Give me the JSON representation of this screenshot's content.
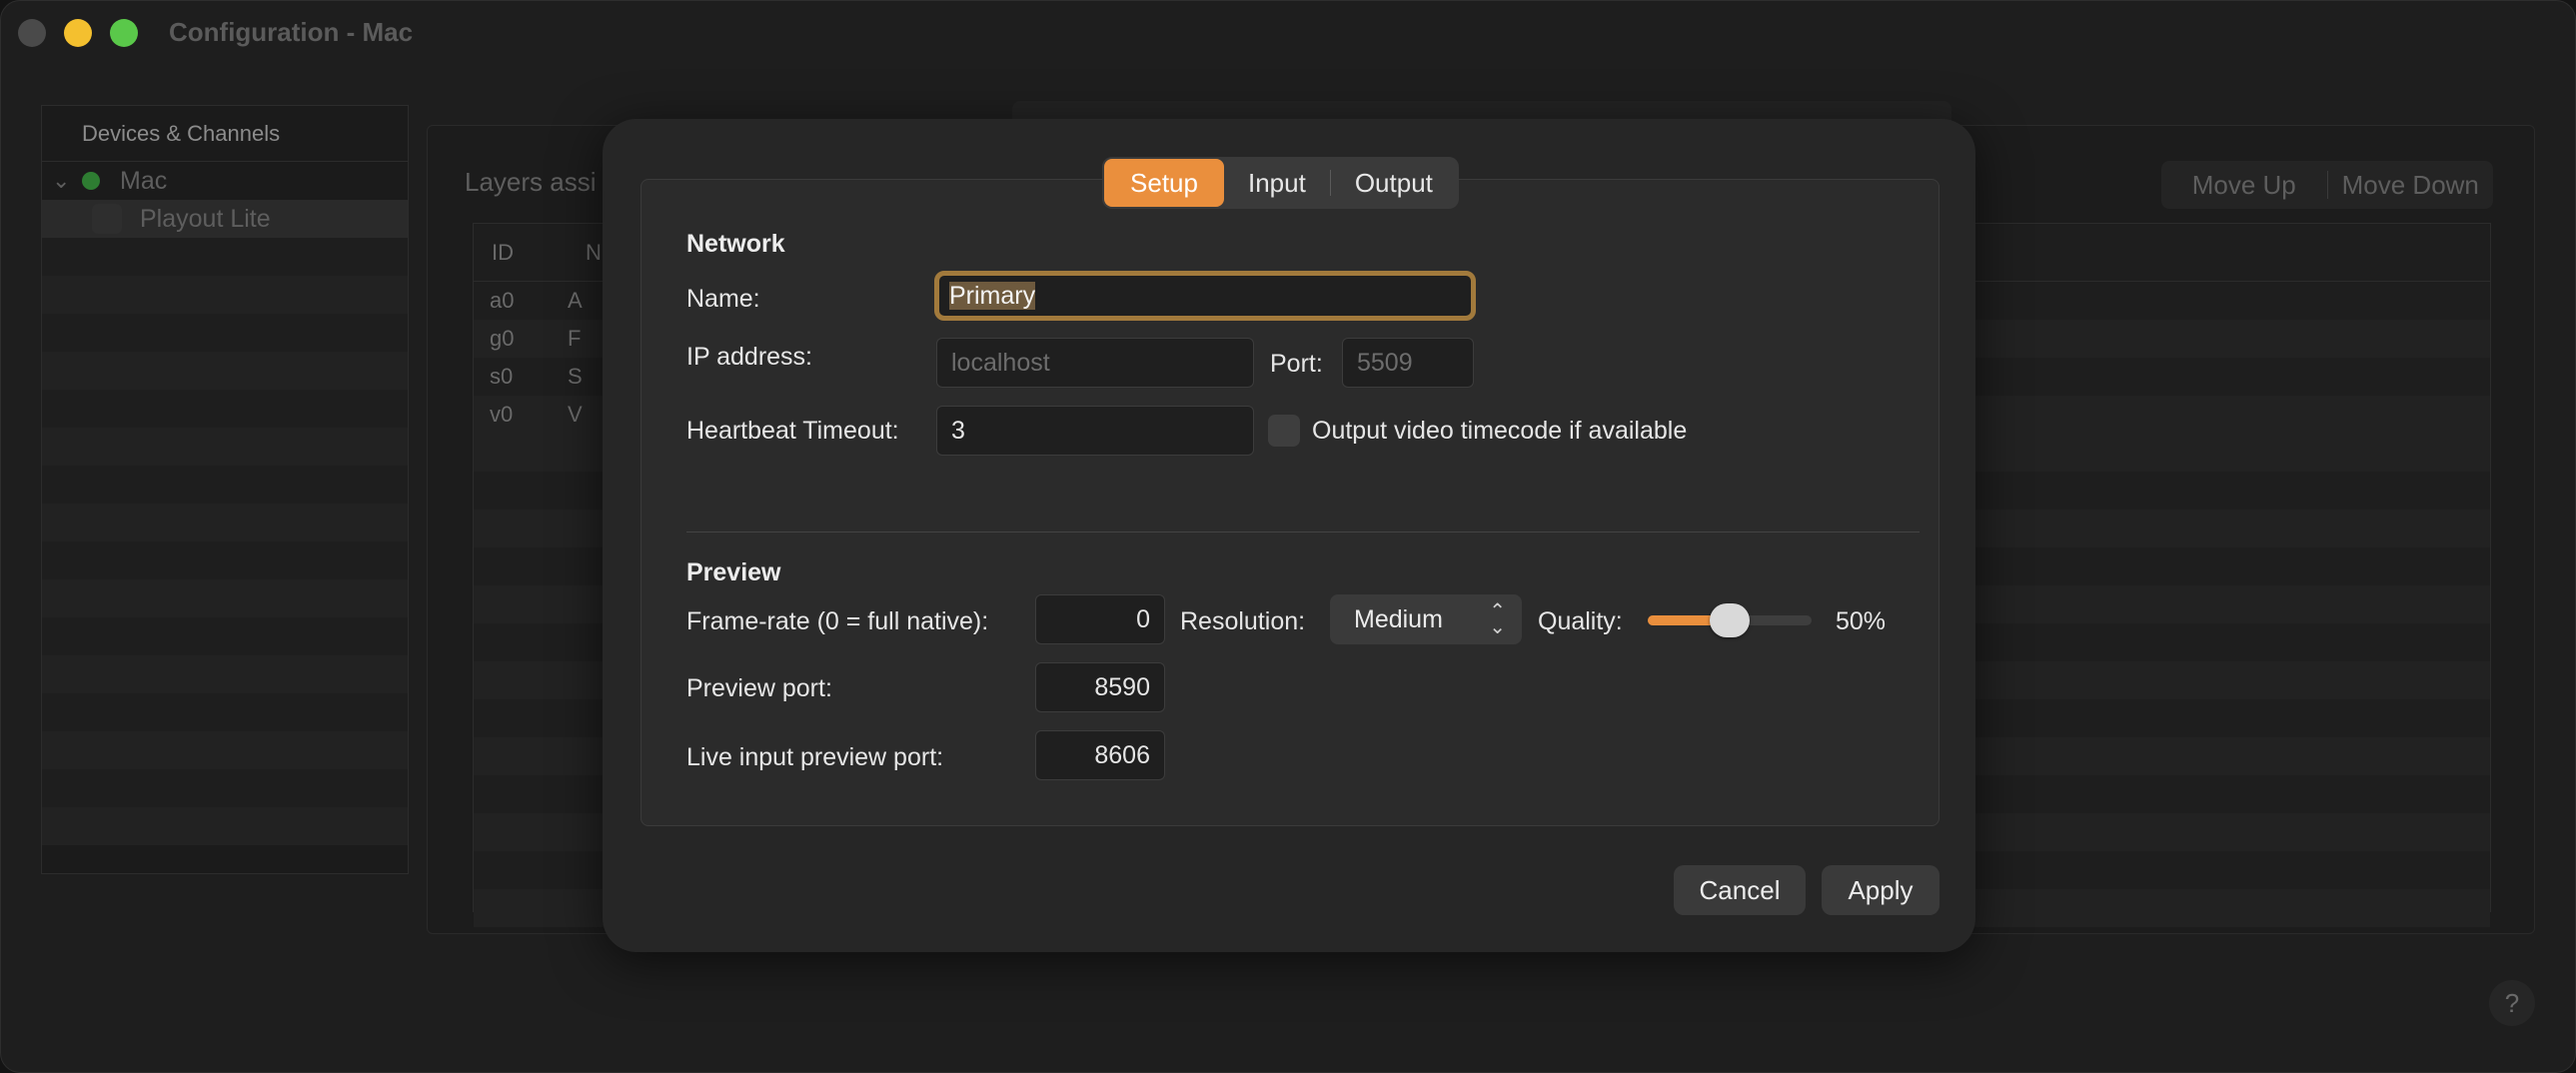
{
  "window": {
    "title": "Configuration - Mac"
  },
  "sidebar": {
    "header": "Devices & Channels",
    "device": {
      "name": "Mac",
      "status_color": "#2e7d32"
    },
    "channel": {
      "name": "Playout Lite"
    }
  },
  "background": {
    "section_label": "Layers assi",
    "move_up": "Move Up",
    "move_down": "Move Down",
    "table": {
      "headers": [
        "ID",
        "N"
      ],
      "rows": [
        {
          "id": "a0",
          "name": "A"
        },
        {
          "id": "g0",
          "name": "F"
        },
        {
          "id": "s0",
          "name": "S"
        },
        {
          "id": "v0",
          "name": "V"
        }
      ]
    },
    "help": "?"
  },
  "dialog": {
    "tabs": {
      "setup": "Setup",
      "input": "Input",
      "output": "Output",
      "active": "Setup"
    },
    "network": {
      "title": "Network",
      "name_label": "Name:",
      "name_value": "Primary",
      "ip_label": "IP address:",
      "ip_placeholder": "localhost",
      "port_label": "Port:",
      "port_placeholder": "5509",
      "heartbeat_label": "Heartbeat Timeout:",
      "heartbeat_value": "3",
      "timecode_label": "Output video timecode if available",
      "timecode_checked": false
    },
    "preview": {
      "title": "Preview",
      "framerate_label": "Frame-rate (0 = full native):",
      "framerate_value": "0",
      "resolution_label": "Resolution:",
      "resolution_value": "Medium",
      "quality_label": "Quality:",
      "quality_value": "50%",
      "quality_fraction": 0.5,
      "preview_port_label": "Preview port:",
      "preview_port_value": "8590",
      "live_port_label": "Live input preview port:",
      "live_port_value": "8606"
    },
    "cancel": "Cancel",
    "apply": "Apply"
  },
  "colors": {
    "accent": "#ea8f3d",
    "focus_ring": "#a27a3c"
  }
}
